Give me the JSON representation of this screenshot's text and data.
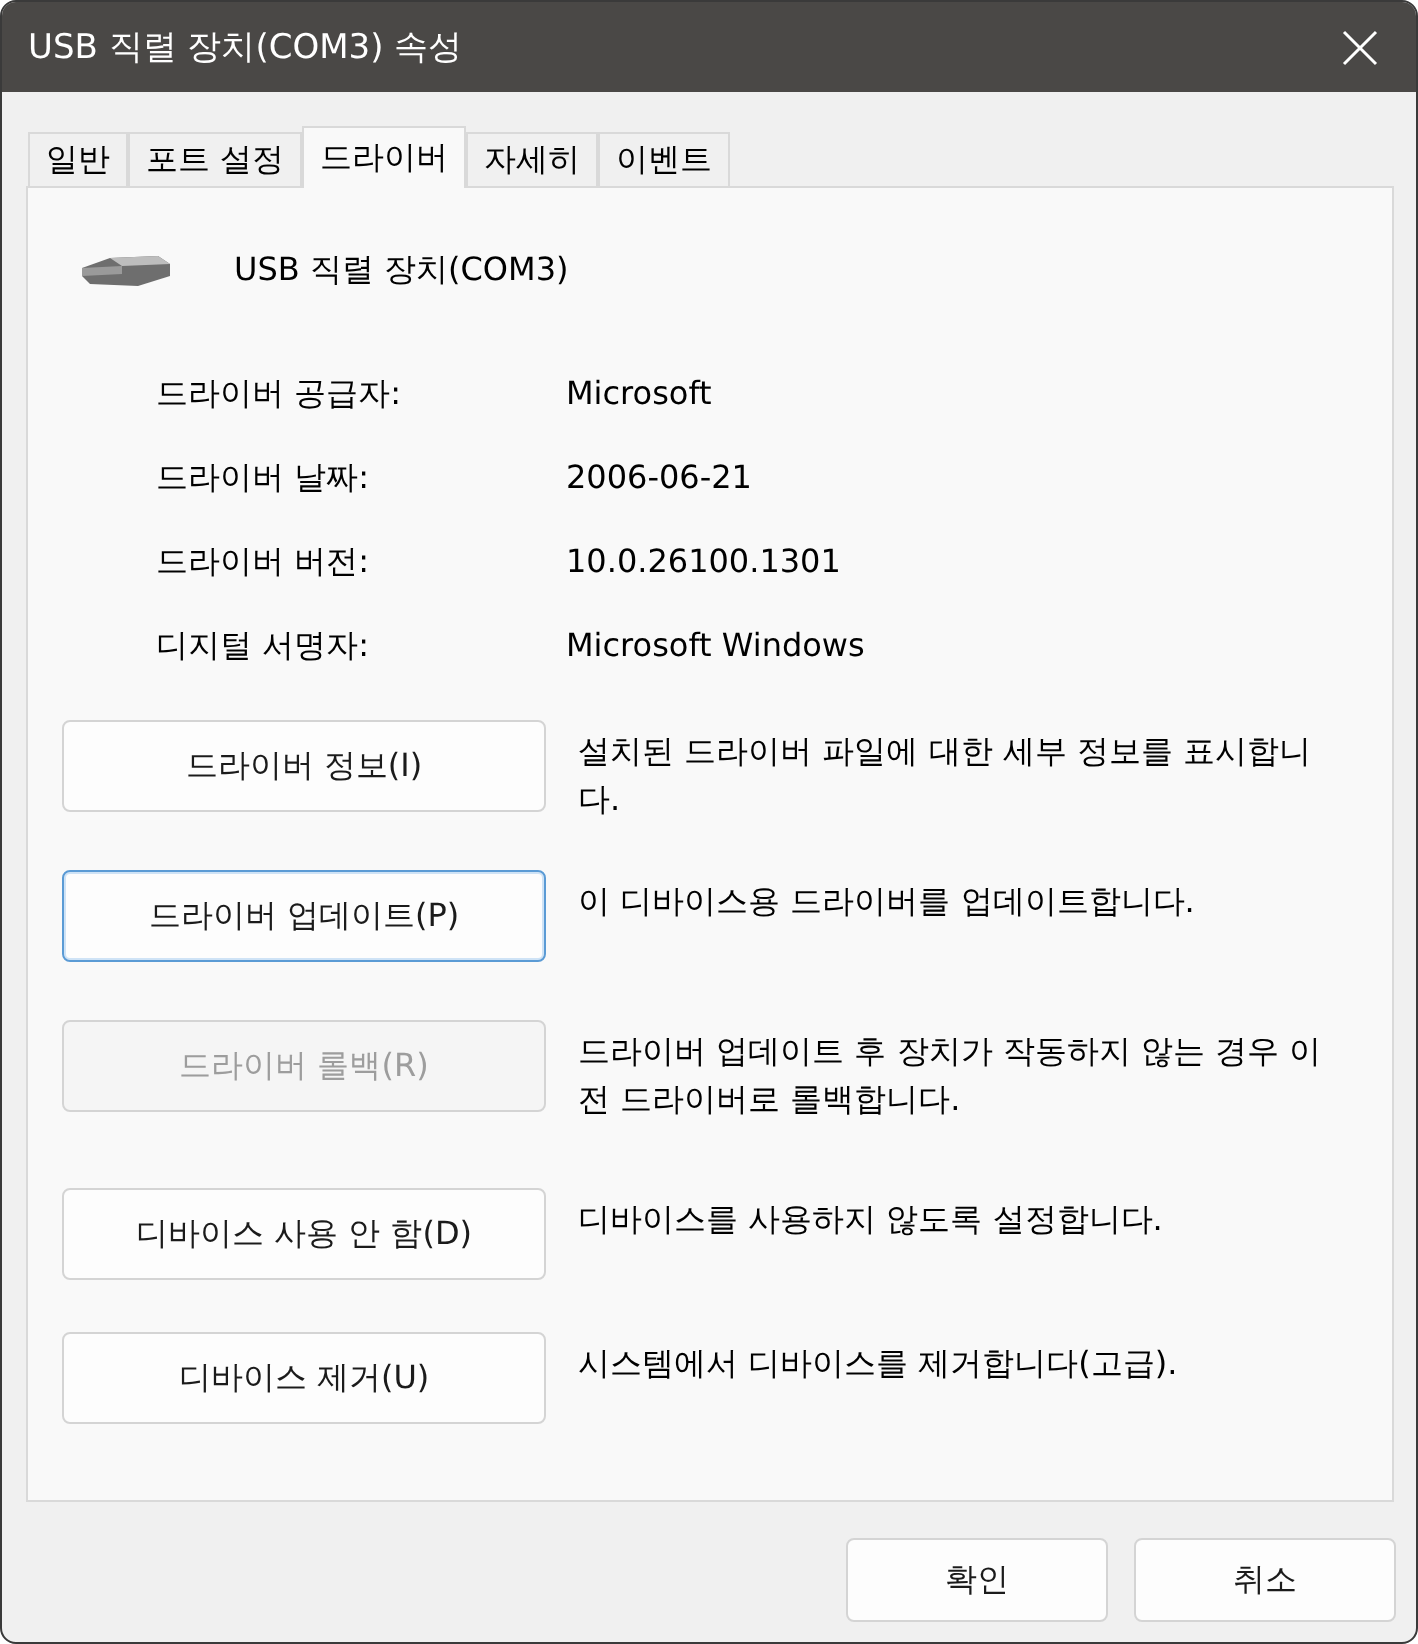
{
  "window": {
    "title": "USB 직렬 장치(COM3) 속성"
  },
  "tabs": [
    {
      "label": "일반",
      "selected": false
    },
    {
      "label": "포트 설정",
      "selected": false
    },
    {
      "label": "드라이버",
      "selected": true
    },
    {
      "label": "자세히",
      "selected": false
    },
    {
      "label": "이벤트",
      "selected": false
    }
  ],
  "device": {
    "name": "USB 직렬 장치(COM3)"
  },
  "properties": [
    {
      "label": "드라이버 공급자:",
      "value": "Microsoft"
    },
    {
      "label": "드라이버 날짜:",
      "value": "2006-06-21"
    },
    {
      "label": "드라이버 버전:",
      "value": "10.0.26100.1301"
    },
    {
      "label": "디지털 서명자:",
      "value": "Microsoft Windows"
    }
  ],
  "actions": [
    {
      "button": "드라이버 정보(I)",
      "description": "설치된 드라이버 파일에 대한 세부 정보를 표시합니다.",
      "disabled": false,
      "focused": false
    },
    {
      "button": "드라이버 업데이트(P)",
      "description": "이 디바이스용 드라이버를 업데이트합니다.",
      "disabled": false,
      "focused": true
    },
    {
      "button": "드라이버 롤백(R)",
      "description": "드라이버 업데이트 후 장치가 작동하지 않는 경우 이전 드라이버로 롤백합니다.",
      "disabled": true,
      "focused": false
    },
    {
      "button": "디바이스 사용 안 함(D)",
      "description": "디바이스를 사용하지 않도록 설정합니다.",
      "disabled": false,
      "focused": false
    },
    {
      "button": "디바이스 제거(U)",
      "description": "시스템에서 디바이스를 제거합니다(고급).",
      "disabled": false,
      "focused": false
    }
  ],
  "footer_buttons": [
    "확인",
    "취소"
  ]
}
